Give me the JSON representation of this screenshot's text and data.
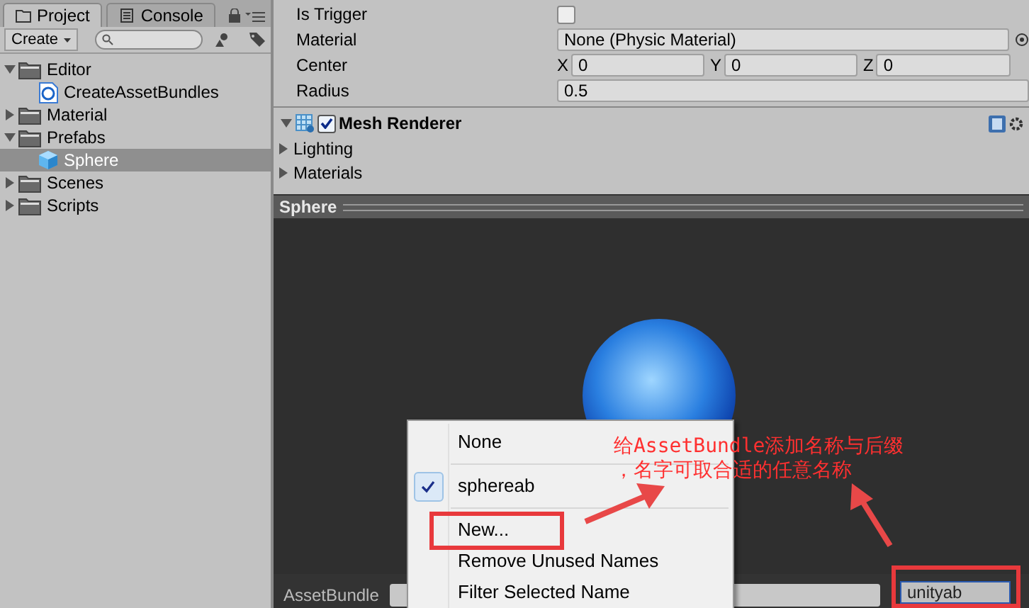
{
  "project_panel": {
    "tabs": [
      {
        "label": "Project",
        "selected": true
      },
      {
        "label": "Console",
        "selected": false
      }
    ],
    "create_button": "Create",
    "tree": [
      {
        "label": "Editor",
        "kind": "folder",
        "expanded": true,
        "selected": false,
        "children": [
          {
            "label": "CreateAssetBundles",
            "kind": "script",
            "selected": false
          }
        ]
      },
      {
        "label": "Material",
        "kind": "folder",
        "expanded": false,
        "selected": false
      },
      {
        "label": "Prefabs",
        "kind": "folder",
        "expanded": true,
        "selected": false,
        "children": [
          {
            "label": "Sphere",
            "kind": "prefab",
            "selected": true
          }
        ]
      },
      {
        "label": "Scenes",
        "kind": "folder",
        "expanded": false,
        "selected": false
      },
      {
        "label": "Scripts",
        "kind": "folder",
        "expanded": false,
        "selected": false
      }
    ]
  },
  "inspector": {
    "rows": [
      {
        "label": "Is Trigger",
        "kind": "checkbox",
        "checked": false
      },
      {
        "label": "Material",
        "kind": "object",
        "value": "None (Physic Material)"
      },
      {
        "label": "Center",
        "kind": "vector",
        "axes": [
          {
            "axis": "X",
            "value": "0"
          },
          {
            "axis": "Y",
            "value": "0"
          },
          {
            "axis": "Z",
            "value": "0"
          }
        ]
      },
      {
        "label": "Radius",
        "kind": "float",
        "value": "0.5"
      }
    ],
    "component": {
      "title": "Mesh Renderer",
      "enabled": true,
      "expanded": true
    },
    "foldouts": [
      {
        "label": "Lighting",
        "expanded": false
      },
      {
        "label": "Materials",
        "expanded": false
      }
    ]
  },
  "preview": {
    "title": "Sphere"
  },
  "asset_bundle": {
    "label": "AssetBundle",
    "name_field": {
      "value": "unityab",
      "annotated": true
    }
  },
  "menu": {
    "items": [
      {
        "kind": "item",
        "label": "None",
        "checked": false,
        "annotated": false
      },
      {
        "kind": "separator"
      },
      {
        "kind": "item",
        "label": "sphereab",
        "checked": true,
        "annotated": false
      },
      {
        "kind": "separator"
      },
      {
        "kind": "item",
        "label": "New...",
        "checked": false,
        "annotated": true
      },
      {
        "kind": "item",
        "label": "Remove Unused Names",
        "checked": false,
        "annotated": false
      },
      {
        "kind": "item",
        "label": "Filter Selected Name",
        "checked": false,
        "annotated": false
      }
    ]
  },
  "annotation": {
    "lines": [
      "给AssetBundle添加名称与后缀",
      "，名字可取合适的任意名称"
    ]
  }
}
